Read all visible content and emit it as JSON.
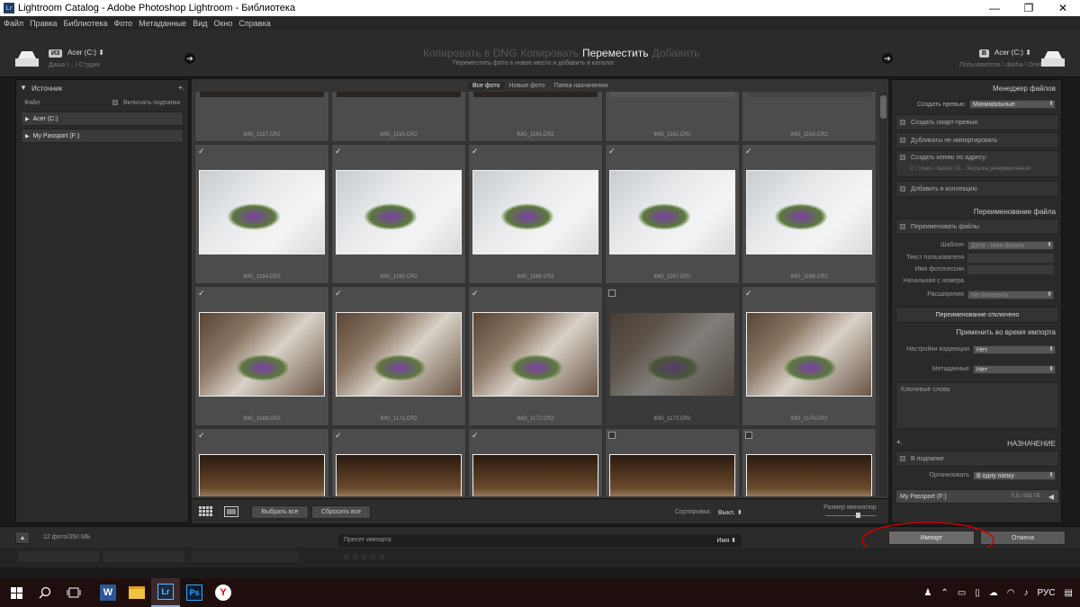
{
  "window": {
    "title": "Lightroom Catalog - Adobe Photoshop Lightroom - Библиотека",
    "app_icon": "Lr",
    "buttons": [
      "—",
      "❐",
      "✕"
    ]
  },
  "menu": [
    "Файл",
    "Правка",
    "Библиотека",
    "Фото",
    "Метаданные",
    "Вид",
    "Окно",
    "Справка"
  ],
  "header": {
    "source": {
      "tag": "ИЗ",
      "drive": "Acer (C:) ⬍",
      "path": "Даша \\ ...\\ Студия"
    },
    "modes": [
      "Копировать в DNG",
      "Копировать",
      "Переместить",
      "Добавить"
    ],
    "active_mode": "Переместить",
    "mode_hint": "Переместить фото в новое место и добавить в каталог.",
    "dest": {
      "tag": "В",
      "drive": "Acer (C:) ⬍",
      "path": "Пользователи \\ dasha \\ OneDrive"
    }
  },
  "left": {
    "title": "Источник",
    "plus": "+.",
    "file_label": "Файл",
    "include_subfolders": "Включать подпапки",
    "drives": [
      "Acer (C:)",
      "My Passport (F:)"
    ]
  },
  "filters": [
    "Все фото",
    "Новые фото",
    "Папка назначения"
  ],
  "grid": {
    "top_row": [
      "IMG_1157.CR2",
      "IMG_1160.CR2",
      "IMG_1161.CR2",
      "IMG_1162.CR2",
      "IMG_1163.CR2"
    ],
    "rows": [
      {
        "names": [
          "IMG_1164.CR2",
          "IMG_1165.CR2",
          "IMG_1166.CR2",
          "IMG_1167.CR2",
          "IMG_1168.CR2"
        ],
        "checked": [
          true,
          true,
          true,
          true,
          true
        ],
        "kind": "flower"
      },
      {
        "names": [
          "IMG_1169.CR2",
          "IMG_1171.CR2",
          "IMG_1172.CR2",
          "IMG_1173.CR2",
          "IMG_1174.CR2"
        ],
        "checked": [
          true,
          true,
          true,
          false,
          true
        ],
        "kind": "dress"
      },
      {
        "names": [
          "",
          "",
          "",
          "",
          ""
        ],
        "checked": [
          true,
          true,
          true,
          false,
          false
        ],
        "kind": "warm"
      }
    ],
    "check_mark": "✓"
  },
  "toolbar": {
    "select_all": "Выбрать все",
    "deselect_all": "Сбросить все",
    "sort_label": "Сортировка:",
    "sort_value": "Выкл. ⬍",
    "thumb_size": "Размер миниатюр"
  },
  "right": {
    "file_handling": "Менеджер файлов",
    "build_previews": "Создать превью",
    "previews_value": "Минимальные",
    "smart_previews": "Создать смарт-превью",
    "no_duplicates": "Дубликаты не импортировать",
    "second_copy": "Создать копию по адресу:",
    "second_copy_path": "C:\\ Users \\ dasha \\ O... Загрузка резервирования",
    "add_collection": "Добавить в коллекцию",
    "file_renaming": "Переименование файла",
    "rename_files": "Переименовать файлы",
    "template_lbl": "Шаблон",
    "template_val": "Дата - Имя файла",
    "custom_text_lbl": "Текст пользователя",
    "shoot_name_lbl": "Имя фотосессии",
    "start_number_lbl": "Начальная с номера",
    "extensions_lbl": "Расширения",
    "extensions_val": "Не изменять",
    "renaming_off": "Переименование отключено",
    "apply_during": "Применить во время импорта",
    "develop_lbl": "Настройки коррекции",
    "develop_val": "Нет",
    "metadata_lbl": "Метаданные",
    "metadata_val": "Нет",
    "keywords_lbl": "Ключевые слова",
    "destination": "НАЗНАЧЕНИЕ",
    "plus": "+.",
    "into_subfolder": "В подпапке",
    "organize_lbl": "Организовать",
    "organize_val": "В одну папку",
    "dest_drive": "My Passport (F:)",
    "dest_space": "5,5 / 931 ГБ"
  },
  "bottom": {
    "count": "12 фото/350 МБ",
    "preset_lbl": "Пресет импорта:",
    "preset_val": "Имя ⬍",
    "import_btn": "Импорт",
    "cancel_btn": "Отмена"
  },
  "taskbar": {
    "lang": "РУС",
    "icons": [
      "windows-icon",
      "search-icon",
      "task-view-icon",
      "word-icon",
      "explorer-icon",
      "lightroom-icon",
      "photoshop-icon",
      "yandex-icon"
    ]
  },
  "colors": {
    "annotation": "#cc0000",
    "checked": "#dddddd"
  }
}
